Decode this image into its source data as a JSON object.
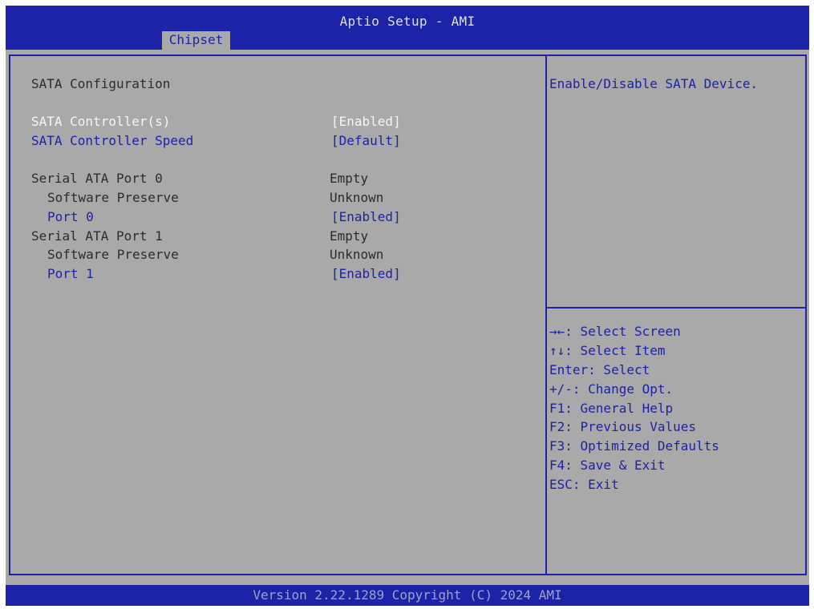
{
  "header": {
    "title": "Aptio Setup - AMI",
    "active_tab": "Chipset"
  },
  "main": {
    "section_title": "SATA Configuration",
    "items": [
      {
        "label": "SATA Controller(s)",
        "value": "[Enabled]"
      },
      {
        "label": "SATA Controller Speed",
        "value": "[Default]"
      },
      {
        "label": "Serial ATA Port 0",
        "value": "Empty"
      },
      {
        "label": "Software Preserve",
        "value": "Unknown"
      },
      {
        "label": "Port 0",
        "value": "[Enabled]"
      },
      {
        "label": "Serial ATA Port 1",
        "value": "Empty"
      },
      {
        "label": "Software Preserve",
        "value": "Unknown"
      },
      {
        "label": "Port 1",
        "value": "[Enabled]"
      }
    ]
  },
  "help": {
    "description": "Enable/Disable SATA Device.",
    "keys": [
      "→←: Select Screen",
      "↑↓: Select Item",
      "Enter: Select",
      "+/-: Change Opt.",
      "F1: General Help",
      "F2: Previous Values",
      "F3: Optimized Defaults",
      "F4: Save & Exit",
      "ESC: Exit"
    ]
  },
  "footer": {
    "version": "Version 2.22.1289 Copyright (C) 2024 AMI"
  },
  "colors": {
    "bios_blue": "#1c23a6",
    "background_gray": "#a9a9a9",
    "selected_white": "#f5f5f5"
  }
}
